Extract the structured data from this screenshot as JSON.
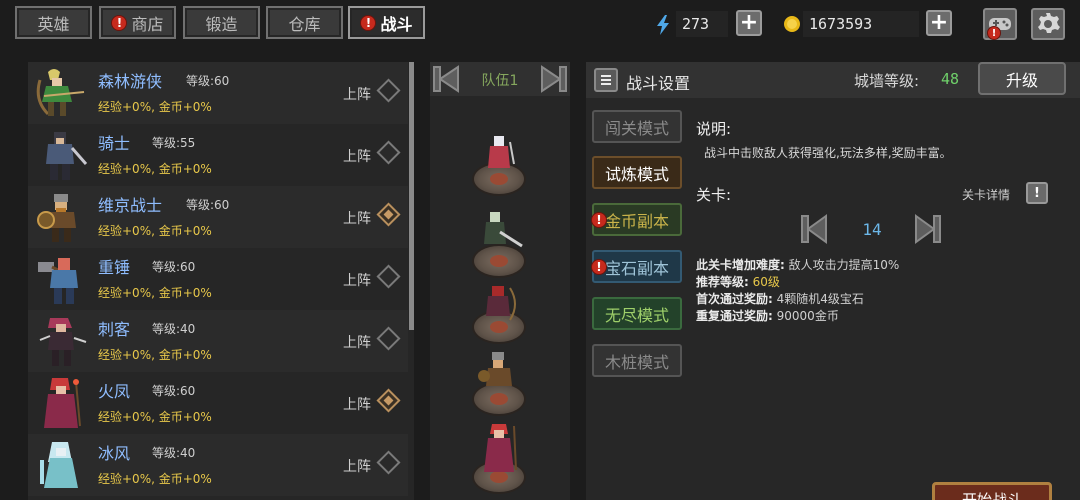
{
  "tabs": [
    {
      "label": "英雄",
      "alert": false,
      "active": false
    },
    {
      "label": "商店",
      "alert": true,
      "active": false
    },
    {
      "label": "锻造",
      "alert": false,
      "active": false
    },
    {
      "label": "仓库",
      "alert": false,
      "active": false
    },
    {
      "label": "战斗",
      "alert": true,
      "active": true
    }
  ],
  "resources": {
    "energy": "273",
    "gold": "1673593"
  },
  "heroes": [
    {
      "name": "森林游侠",
      "level": "等级:60",
      "stats": "经验+0%, 金币+0%",
      "deploy": "上阵",
      "deployed": false
    },
    {
      "name": "骑士",
      "level": "等级:55",
      "stats": "经验+0%, 金币+0%",
      "deploy": "上阵",
      "deployed": false
    },
    {
      "name": "维京战士",
      "level": "等级:60",
      "stats": "经验+0%, 金币+0%",
      "deploy": "上阵",
      "deployed": true
    },
    {
      "name": "重锤",
      "level": "等级:60",
      "stats": "经验+0%, 金币+0%",
      "deploy": "上阵",
      "deployed": false
    },
    {
      "name": "刺客",
      "level": "等级:40",
      "stats": "经验+0%, 金币+0%",
      "deploy": "上阵",
      "deployed": false
    },
    {
      "name": "火凤",
      "level": "等级:60",
      "stats": "经验+0%, 金币+0%",
      "deploy": "上阵",
      "deployed": true
    },
    {
      "name": "冰风",
      "level": "等级:40",
      "stats": "经验+0%, 金币+0%",
      "deploy": "上阵",
      "deployed": false
    }
  ],
  "team": {
    "title": "队伍1"
  },
  "settings": {
    "title": "战斗设置",
    "wall_label": "城墙等级:",
    "wall_level": "48",
    "upgrade": "升级",
    "modes": [
      {
        "label": "闯关模式",
        "style": "gray",
        "alert": false
      },
      {
        "label": "试炼模式",
        "style": "brown",
        "alert": false
      },
      {
        "label": "金币副本",
        "style": "gold",
        "alert": true
      },
      {
        "label": "宝石副本",
        "style": "blue",
        "alert": true
      },
      {
        "label": "无尽模式",
        "style": "green",
        "alert": false
      },
      {
        "label": "木桩模式",
        "style": "gray",
        "alert": false
      }
    ],
    "desc_label": "说明:",
    "desc_text": "战斗中击败敌人获得强化,玩法多样,奖励丰富。",
    "stage_label": "关卡:",
    "stage_detail": "关卡详情",
    "stage_number": "14",
    "difficulty_label": "此关卡增加难度:",
    "difficulty_value": "敌人攻击力提高10%",
    "rec_label": "推荐等级:",
    "rec_value": "60级",
    "first_label": "首次通过奖励:",
    "first_value": "4颗随机4级宝石",
    "repeat_label": "重复通过奖励:",
    "repeat_value": "90000金币",
    "start": "开始战斗"
  },
  "colors": {
    "hero_name": "#8fbdff",
    "stats": "#e8c84a",
    "wall_level": "#6fd06a",
    "stage_number": "#6cb8ea",
    "alert": "#c62a1d"
  }
}
